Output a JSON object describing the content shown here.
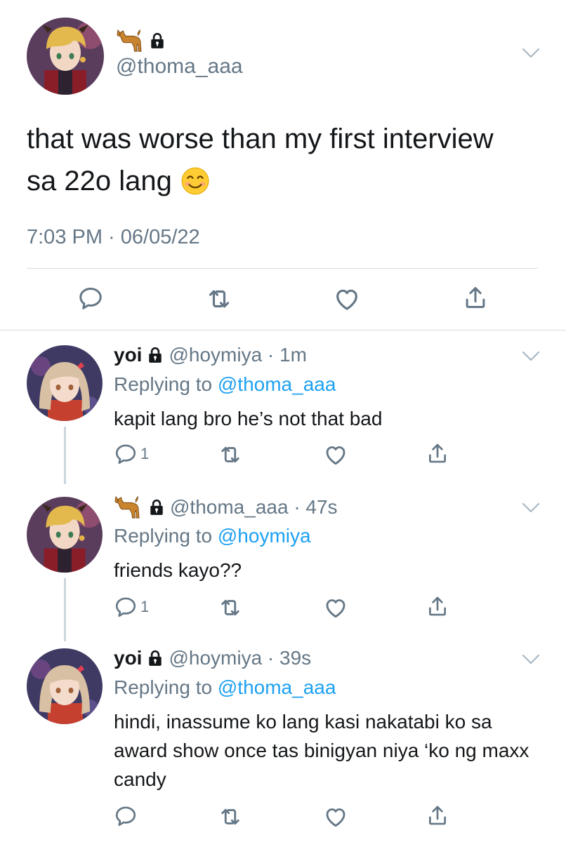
{
  "main_tweet": {
    "name_emoji": "dog-icon",
    "handle": "@thoma_aaa",
    "text_line1": "that was worse than my first interview",
    "text_line2": "sa 22o lang",
    "emoji": "smiling-face-icon",
    "timestamp": "7:03 PM · 06/05/22"
  },
  "replies": [
    {
      "name": "yoi",
      "handle": "@hoymiya · 1m",
      "replying_prefix": "Replying to ",
      "replying_to": "@thoma_aaa",
      "text": "kapit lang bro he’s not that bad",
      "reply_count": "1"
    },
    {
      "name": "",
      "name_emoji": "dog-icon",
      "handle": "@thoma_aaa · 47s",
      "replying_prefix": "Replying to ",
      "replying_to": "@hoymiya",
      "text": "friends kayo??",
      "reply_count": "1"
    },
    {
      "name": "yoi",
      "handle": "@hoymiya · 39s",
      "replying_prefix": "Replying to ",
      "replying_to": "@thoma_aaa",
      "text": "hindi, inassume ko lang kasi nakatabi ko sa award show once tas binigyan niya ‘ko ng maxx candy",
      "reply_count": ""
    }
  ],
  "colors": {
    "link": "#1da1f2",
    "secondary": "#657786",
    "divider": "#d9dee2"
  }
}
